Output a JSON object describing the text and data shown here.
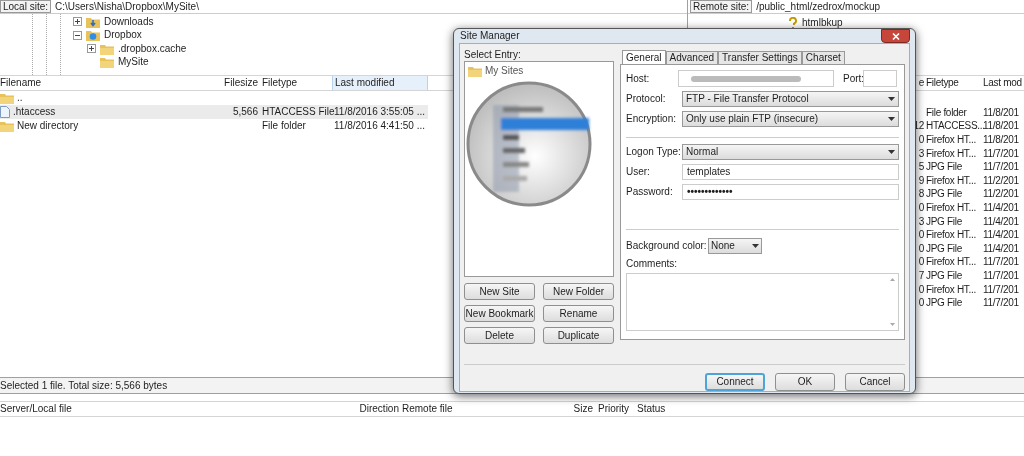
{
  "local_site": {
    "label": "Local site:",
    "path": "C:\\Users\\Nisha\\Dropbox\\MySite\\"
  },
  "local_tree": [
    {
      "name": "Downloads",
      "kind": "downloads",
      "expanded": false
    },
    {
      "name": "Dropbox",
      "kind": "dropbox",
      "expanded": true,
      "children": [
        {
          "name": ".dropbox.cache",
          "kind": "folder",
          "expanded": false
        },
        {
          "name": "MySite",
          "kind": "folder"
        }
      ]
    }
  ],
  "local_files": {
    "columns": [
      {
        "label": "Filename",
        "sorted": false
      },
      {
        "label": "Filesize",
        "sorted": false
      },
      {
        "label": "Filetype",
        "sorted": false
      },
      {
        "label": "Last modified",
        "sorted": true
      }
    ],
    "rows": [
      {
        "kind": "folder",
        "name": "..",
        "selected": false
      },
      {
        "kind": "file",
        "name": ".htaccess",
        "size": "5,566",
        "type": "HTACCESS File",
        "modified": "11/8/2016 3:55:05 ...",
        "selected": true
      },
      {
        "kind": "folder",
        "name": "New directory",
        "type": "File folder",
        "modified": "11/8/2016 4:41:50 ...",
        "selected": false
      }
    ]
  },
  "remote_site": {
    "label": "Remote site:",
    "path": "/public_html/zedrox/mockup"
  },
  "remote_tree": [
    {
      "name": "htmlbkup",
      "kind": "unknown"
    }
  ],
  "remote_files": {
    "columns": [
      "e",
      "Filetype",
      "Last mod"
    ],
    "rows": [
      {
        "column_1": "",
        "type": "File folder",
        "modified": "11/8/201"
      },
      {
        "column_1": "12",
        "type": "HTACCESS...",
        "modified": "11/8/201"
      },
      {
        "column_1": "0",
        "type": "Firefox HT...",
        "modified": "11/8/201"
      },
      {
        "column_1": "3",
        "type": "Firefox HT...",
        "modified": "11/7/201"
      },
      {
        "column_1": "5",
        "type": "JPG File",
        "modified": "11/7/201"
      },
      {
        "column_1": "9",
        "type": "Firefox HT...",
        "modified": "11/2/201"
      },
      {
        "column_1": "8",
        "type": "JPG File",
        "modified": "11/2/201"
      },
      {
        "column_1": "0",
        "type": "Firefox HT...",
        "modified": "11/4/201"
      },
      {
        "column_1": "3",
        "type": "JPG File",
        "modified": "11/4/201"
      },
      {
        "column_1": "0",
        "type": "Firefox HT...",
        "modified": "11/4/201"
      },
      {
        "column_1": "0",
        "type": "JPG File",
        "modified": "11/4/201"
      },
      {
        "column_1": "0",
        "type": "Firefox HT...",
        "modified": "11/7/201"
      },
      {
        "column_1": "7",
        "type": "JPG File",
        "modified": "11/7/201"
      },
      {
        "column_1": "0",
        "type": "Firefox HT...",
        "modified": "11/7/201"
      },
      {
        "column_1": "0",
        "type": "JPG File",
        "modified": "11/7/201"
      }
    ]
  },
  "status_bar": "Selected 1 file. Total size: 5,566 bytes",
  "queue_columns": [
    "Server/Local file",
    "Direction",
    "Remote file",
    "Size",
    "Priority",
    "Status"
  ],
  "dialog": {
    "title": "Site Manager",
    "select_label": "Select Entry:",
    "root": "My Sites",
    "entry_buttons": [
      "New Site",
      "New Folder",
      "New Bookmark",
      "Rename",
      "Delete",
      "Duplicate"
    ],
    "tabs": [
      {
        "label": "General",
        "selected": true
      },
      {
        "label": "Advanced",
        "selected": false
      },
      {
        "label": "Transfer Settings",
        "selected": false
      },
      {
        "label": "Charset",
        "selected": false
      }
    ],
    "host_label": "Host:",
    "port_label": "Port:",
    "connection": [
      {
        "label": "Protocol:",
        "kind": "select",
        "value": "FTP - File Transfer Protocol"
      },
      {
        "label": "Encryption:",
        "kind": "select",
        "value": "Only use plain FTP (insecure)"
      }
    ],
    "logon": [
      {
        "label": "Logon Type:",
        "kind": "select",
        "value": "Normal"
      },
      {
        "label": "User:",
        "kind": "text",
        "value": "templates"
      },
      {
        "label": "Password:",
        "kind": "password",
        "value": "•••••••••••••"
      }
    ],
    "background_color": {
      "label": "Background color:",
      "value": "None"
    },
    "comments_label": "Comments:",
    "footer_buttons": [
      {
        "label": "Connect",
        "default": true
      },
      {
        "label": "OK",
        "default": false
      },
      {
        "label": "Cancel",
        "default": false
      }
    ]
  }
}
